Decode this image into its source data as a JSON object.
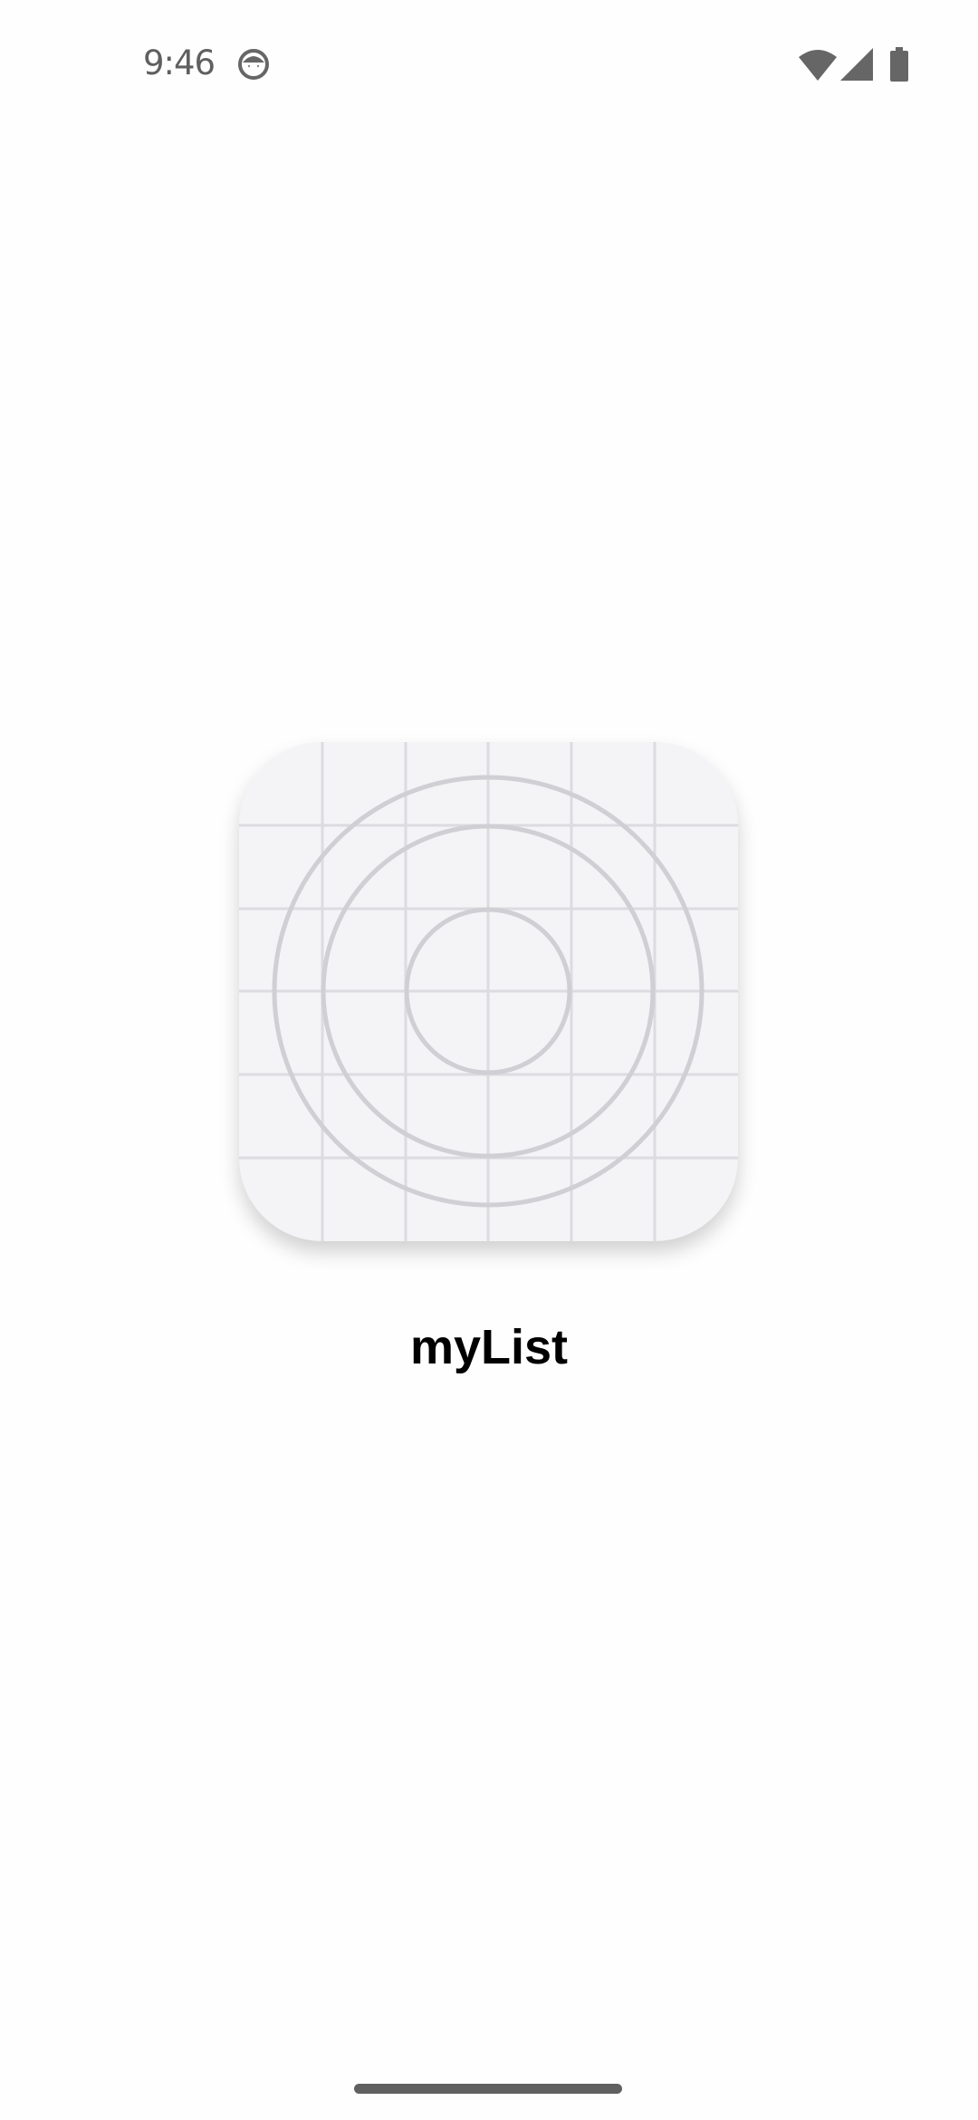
{
  "status_bar": {
    "time": "9:46",
    "icons": [
      "notification-app-icon",
      "wifi-icon",
      "cellular-signal-icon",
      "battery-icon"
    ]
  },
  "splash": {
    "app_name": "myList",
    "icon": "app-icon-placeholder-grid"
  },
  "colors": {
    "background": "#fefefe",
    "icon_bg": "#f4f4f6",
    "grid": "#dcdce0",
    "circles": "#cfcfd4",
    "status_icons": "#666666"
  }
}
